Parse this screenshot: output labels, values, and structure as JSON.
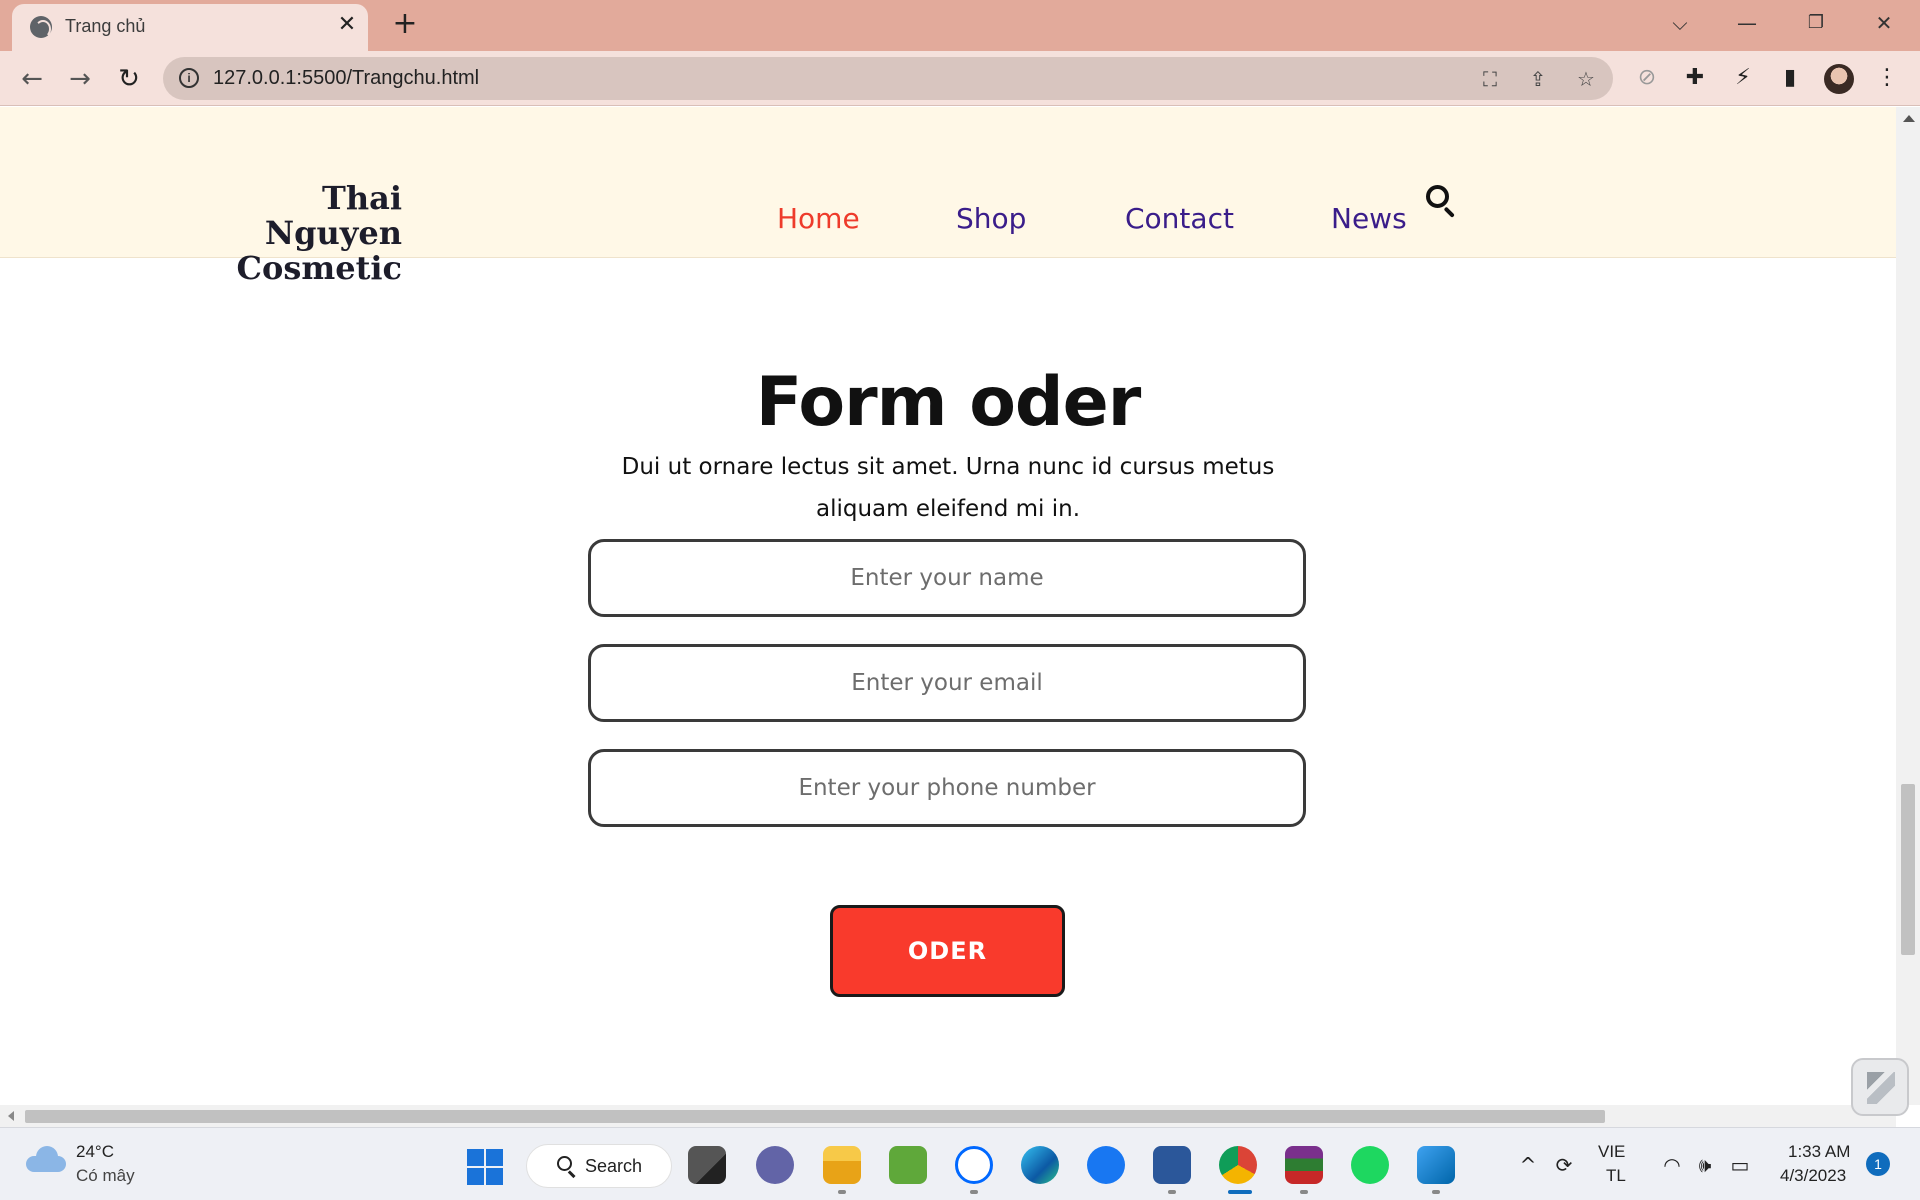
{
  "browser": {
    "tab_title": "Trang chủ",
    "url": "127.0.0.1:5500/Trangchu.html",
    "new_tab_symbol": "+",
    "tab_close_symbol": "✕"
  },
  "site": {
    "brand_line1": "Thai Nguyen",
    "brand_line2": "Cosmetic",
    "nav": [
      {
        "label": "Home",
        "active": true
      },
      {
        "label": "Shop",
        "active": false
      },
      {
        "label": "Contact",
        "active": false
      },
      {
        "label": "News",
        "active": false
      }
    ]
  },
  "form": {
    "title": "Form oder",
    "description": "Dui ut ornare lectus sit amet. Urna nunc id cursus metus aliquam eleifend mi in.",
    "name_placeholder": "Enter your name",
    "email_placeholder": "Enter your email",
    "phone_placeholder": "Enter your phone number",
    "submit_label": "ODER"
  },
  "taskbar": {
    "weather_temp": "24°C",
    "weather_condition": "Có mây",
    "search_label": "Search",
    "lang_line1": "VIE",
    "lang_line2": "TL",
    "time": "1:33 AM",
    "date": "4/3/2023",
    "notification_count": "1"
  },
  "colors": {
    "tabbar_bg": "#e2aa9b",
    "toolbar_bg": "#f5e1dc",
    "header_bg": "#fff8e7",
    "nav_active": "#ee3b2b",
    "nav_default": "#3a1d8a",
    "button_bg": "#f93a2c"
  },
  "icons": {
    "taskbar_apps": [
      "task-view-icon",
      "teams-icon",
      "file-explorer-icon",
      "game-icon",
      "zalo-icon",
      "edge-icon",
      "facebook-icon",
      "word-icon",
      "chrome-icon",
      "winrar-icon",
      "spotify-icon",
      "vscode-icon"
    ]
  }
}
